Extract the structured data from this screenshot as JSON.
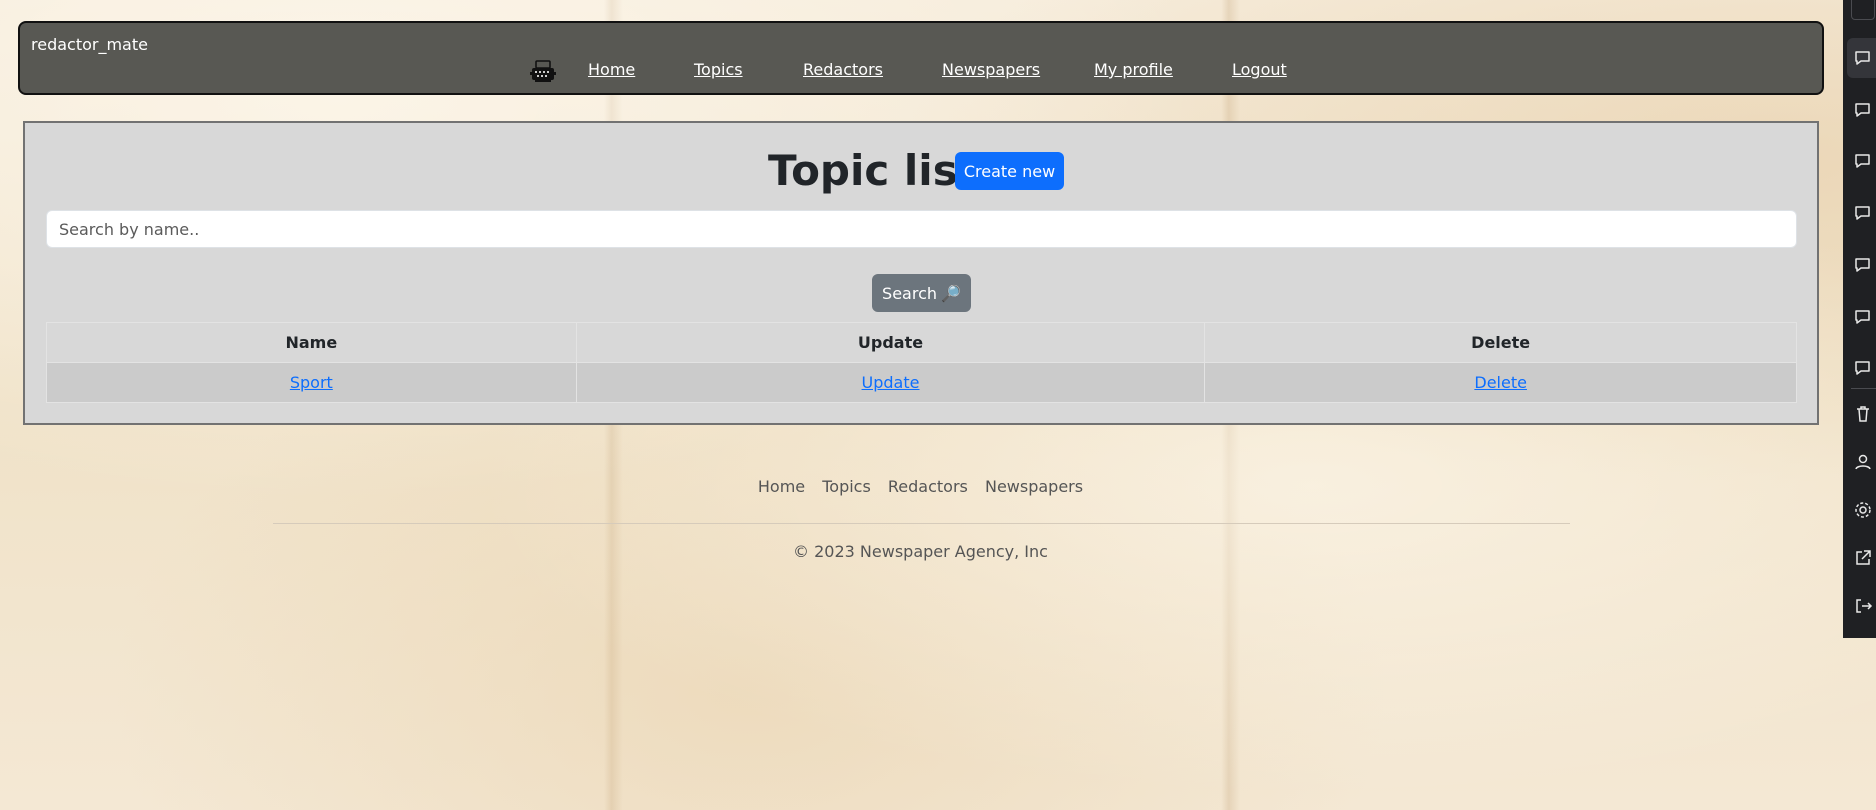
{
  "navbar": {
    "brand": "redactor_mate",
    "logo_icon": "typewriter-icon",
    "links": [
      {
        "label": "Home"
      },
      {
        "label": "Topics"
      },
      {
        "label": "Redactors"
      },
      {
        "label": "Newspapers"
      },
      {
        "label": "My profile"
      },
      {
        "label": "Logout"
      }
    ]
  },
  "main": {
    "title": "Topic list",
    "create_button": "Create new",
    "search": {
      "placeholder": "Search by name..",
      "value": "",
      "button_label": "Search",
      "button_icon": "🔎"
    },
    "table": {
      "headers": [
        "Name",
        "Update",
        "Delete"
      ],
      "rows": [
        {
          "name": "Sport",
          "update": "Update",
          "delete": "Delete"
        }
      ]
    }
  },
  "footer": {
    "links": [
      "Home",
      "Topics",
      "Redactors",
      "Newspapers"
    ],
    "copyright": "© 2023 Newspaper Agency, Inc"
  },
  "side_panel": {
    "icons": [
      "comment-icon",
      "comment-icon",
      "comment-icon",
      "comment-icon",
      "comment-icon",
      "comment-icon",
      "comment-icon",
      "trash-icon",
      "user-icon",
      "gear-icon",
      "external-link-icon",
      "logout-icon"
    ]
  },
  "colors": {
    "navbar_bg": "#585853",
    "card_bg": "#d8d8d8",
    "primary": "#0d6efd",
    "secondary": "#6c757d"
  }
}
